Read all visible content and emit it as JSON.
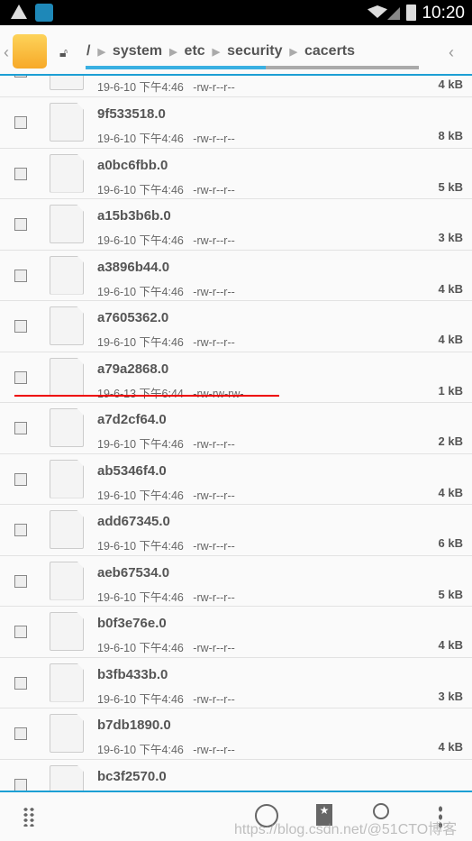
{
  "status_bar": {
    "time": "10:20",
    "icons": [
      "warning-icon",
      "app-icon",
      "wifi-icon",
      "signal-icon",
      "battery-icon"
    ]
  },
  "breadcrumb": [
    "/",
    "system",
    "etc",
    "security",
    "cacerts"
  ],
  "breadcrumb_scroll_percent": 54,
  "partial_top_row": {
    "meta": "19-6-10 下午4:46   -rw-r--r--",
    "size": "4 kB"
  },
  "files": [
    {
      "name": "9f533518.0",
      "meta": "19-6-10 下午4:46   -rw-r--r--",
      "size": "8 kB"
    },
    {
      "name": "a0bc6fbb.0",
      "meta": "19-6-10 下午4:46   -rw-r--r--",
      "size": "5 kB"
    },
    {
      "name": "a15b3b6b.0",
      "meta": "19-6-10 下午4:46   -rw-r--r--",
      "size": "3 kB"
    },
    {
      "name": "a3896b44.0",
      "meta": "19-6-10 下午4:46   -rw-r--r--",
      "size": "4 kB"
    },
    {
      "name": "a7605362.0",
      "meta": "19-6-10 下午4:46   -rw-r--r--",
      "size": "4 kB"
    },
    {
      "name": "a79a2868.0",
      "meta": "19-6-13 下午6:44   -rw-rw-rw-",
      "size": "1 kB"
    },
    {
      "name": "a7d2cf64.0",
      "meta": "19-6-10 下午4:46   -rw-r--r--",
      "size": "2 kB"
    },
    {
      "name": "ab5346f4.0",
      "meta": "19-6-10 下午4:46   -rw-r--r--",
      "size": "4 kB"
    },
    {
      "name": "add67345.0",
      "meta": "19-6-10 下午4:46   -rw-r--r--",
      "size": "6 kB"
    },
    {
      "name": "aeb67534.0",
      "meta": "19-6-10 下午4:46   -rw-r--r--",
      "size": "5 kB"
    },
    {
      "name": "b0f3e76e.0",
      "meta": "19-6-10 下午4:46   -rw-r--r--",
      "size": "4 kB"
    },
    {
      "name": "b3fb433b.0",
      "meta": "19-6-10 下午4:46   -rw-r--r--",
      "size": "3 kB"
    },
    {
      "name": "b7db1890.0",
      "meta": "19-6-10 下午4:46   -rw-r--r--",
      "size": "4 kB"
    },
    {
      "name": "bc3f2570.0",
      "meta": "",
      "size": ""
    }
  ],
  "watermark": "https://blog.csdn.net/@51CTO博客",
  "colors": {
    "accent": "#1c9fd4",
    "highlight_underline": "#e00000"
  }
}
